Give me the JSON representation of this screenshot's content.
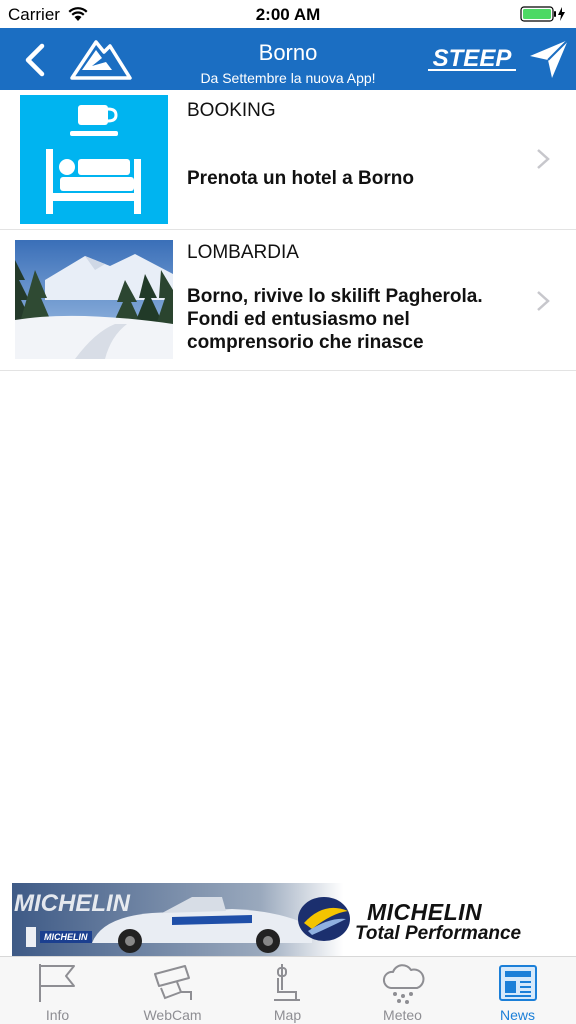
{
  "status_bar": {
    "carrier": "Carrier",
    "time": "2:00 AM"
  },
  "nav": {
    "title": "Borno",
    "subtitle": "Da Settembre la nuova App!",
    "brand": "STEEP",
    "color": "#1b6ec2"
  },
  "news": [
    {
      "category": "BOOKING",
      "text": "Prenota un hotel a Borno",
      "thumb_icon": "hotel-bed-icon"
    },
    {
      "category": "LOMBARDIA",
      "text": "Borno, rivive lo skilift Pagherola. Fondi ed entusiasmo nel comprensorio che rinasce",
      "thumb_icon": "snowy-landscape-photo"
    }
  ],
  "ad": {
    "brand": "MICHELIN",
    "tagline": "Total Performance",
    "small_logo": "MICHELIN"
  },
  "tabs": [
    {
      "label": "Info",
      "icon": "flag-icon",
      "active": false
    },
    {
      "label": "WebCam",
      "icon": "camera-icon",
      "active": false
    },
    {
      "label": "Map",
      "icon": "chairlift-icon",
      "active": false
    },
    {
      "label": "Meteo",
      "icon": "cloud-snow-icon",
      "active": false
    },
    {
      "label": "News",
      "icon": "newspaper-icon",
      "active": true
    }
  ],
  "colors": {
    "accent": "#1b7fd8",
    "booking_bg": "#00b4f0",
    "tab_inactive": "#8e8e93"
  }
}
